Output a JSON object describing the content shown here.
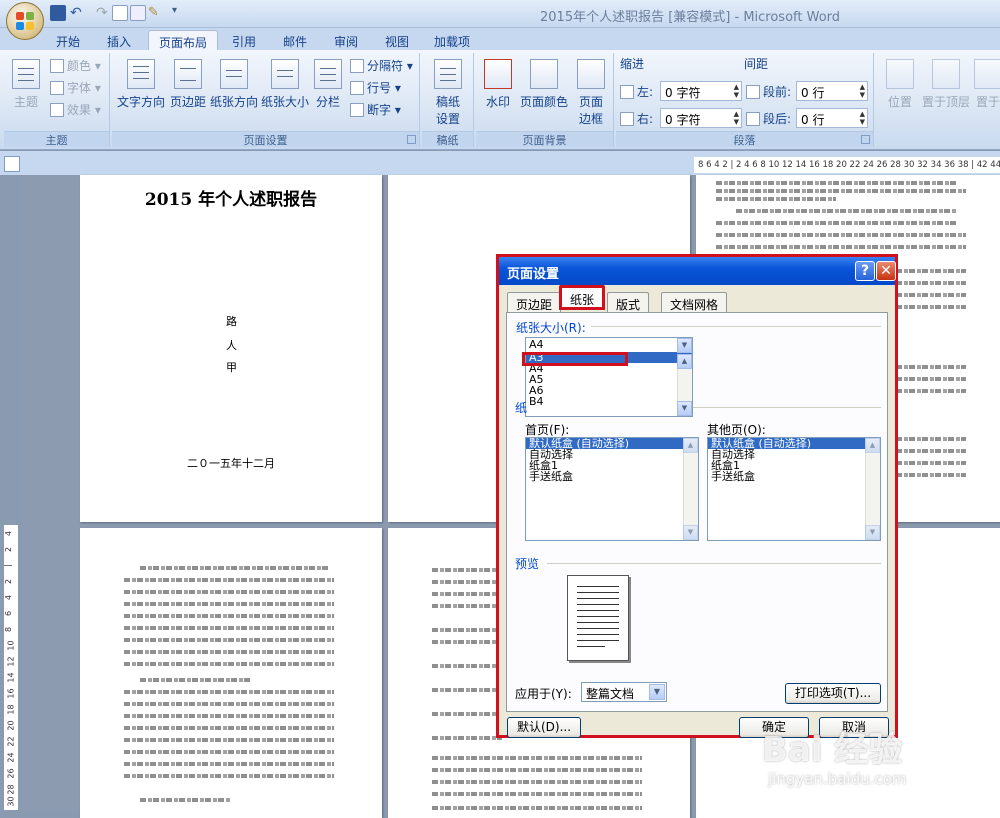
{
  "window": {
    "title": "2015年个人述职报告 [兼容模式] - Microsoft Word"
  },
  "ribbon_tabs": [
    "开始",
    "插入",
    "页面布局",
    "引用",
    "邮件",
    "审阅",
    "视图",
    "加载项"
  ],
  "active_tab": "页面布局",
  "ribbon": {
    "theme": {
      "big": "主题",
      "colors": "颜色",
      "fonts": "字体",
      "effects": "效果",
      "label": "主题"
    },
    "page_setup": {
      "text_direction": "文字方向",
      "margins": "页边距",
      "orientation": "纸张方向",
      "size": "纸张大小",
      "columns": "分栏",
      "breaks": "分隔符",
      "line_numbers": "行号",
      "hyphenation": "断字",
      "label": "页面设置"
    },
    "manuscript": {
      "btn_line1": "稿纸",
      "btn_line2": "设置",
      "label": "稿纸"
    },
    "page_background": {
      "watermark": "水印",
      "page_color": "页面颜色",
      "borders_line1": "页面",
      "borders_line2": "边框",
      "label": "页面背景"
    },
    "paragraph": {
      "indent_title": "缩进",
      "left_label": "左:",
      "left_value": "0 字符",
      "right_label": "右:",
      "right_value": "0 字符",
      "spacing_title": "间距",
      "before_label": "段前:",
      "before_value": "0 行",
      "after_label": "段后:",
      "after_value": "0 行",
      "label": "段落"
    },
    "arrange": {
      "position": "位置",
      "bring_front": "置于顶层",
      "send_back": "置于"
    }
  },
  "ruler": {
    "horizontal_ticks": "8 6 4 2 | 2 4 6 8 10 12 14 16 18 20 22 24 26 28 30 32 34 36 38 | 42 44 46",
    "vertical_ticks": [
      "4",
      "2",
      "|",
      "2",
      "4",
      "6",
      "8",
      "10",
      "12",
      "14",
      "16",
      "18",
      "20",
      "22",
      "24",
      "26",
      "28",
      "30"
    ]
  },
  "page1": {
    "title": "2015 年个人述职报告",
    "author_chars": [
      "路",
      "人",
      "甲"
    ],
    "date": "二０一五年十二月"
  },
  "dialog": {
    "title": "页面设置",
    "tabs": [
      "页边距",
      "纸张",
      "版式",
      "文档网格"
    ],
    "active_tab": "纸张",
    "paper_size_label": "纸张大小(R):",
    "paper_size_current": "A4",
    "paper_size_options": [
      "A3",
      "A4",
      "A5",
      "A6",
      "B4"
    ],
    "paper_size_highlighted": "A3",
    "paper_source_label": "纸",
    "first_page_label": "首页(F):",
    "other_pages_label": "其他页(O):",
    "tray_options": [
      "默认纸盒 (自动选择)",
      "自动选择",
      "纸盒1",
      "手送纸盒"
    ],
    "preview_label": "预览",
    "apply_to_label": "应用于(Y):",
    "apply_to_value": "整篇文档",
    "print_options": "打印选项(T)...",
    "default_button": "默认(D)...",
    "ok_button": "确定",
    "cancel_button": "取消"
  },
  "watermark": {
    "brand": "Bai 经验",
    "url": "jingyan.baidu.com"
  }
}
